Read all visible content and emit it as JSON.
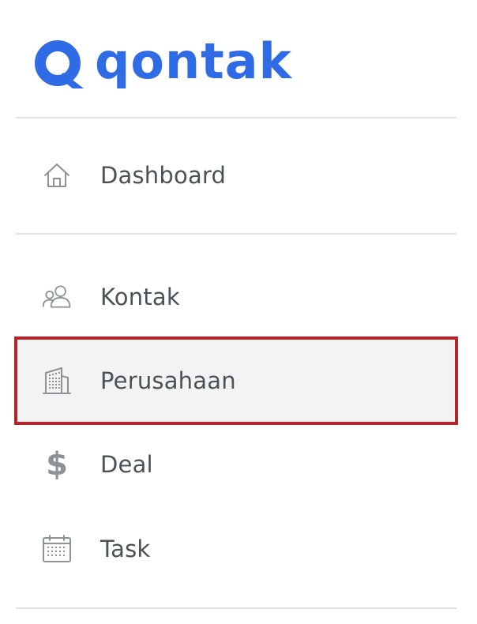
{
  "brand": {
    "name": "qontak",
    "color": "#2f6be5"
  },
  "nav": {
    "items": [
      {
        "id": "dashboard",
        "label": "Dashboard",
        "icon": "home-icon"
      },
      {
        "id": "kontak",
        "label": "Kontak",
        "icon": "users-icon"
      },
      {
        "id": "perusahaan",
        "label": "Perusahaan",
        "icon": "building-icon",
        "active": true
      },
      {
        "id": "deal",
        "label": "Deal",
        "icon": "dollar-icon"
      },
      {
        "id": "task",
        "label": "Task",
        "icon": "calendar-icon"
      }
    ]
  },
  "colors": {
    "text": "#4a5257",
    "icon": "#8d9297",
    "active_background": "#f3f3f3",
    "active_border": "#b0262a",
    "divider": "#e2e2e2"
  }
}
